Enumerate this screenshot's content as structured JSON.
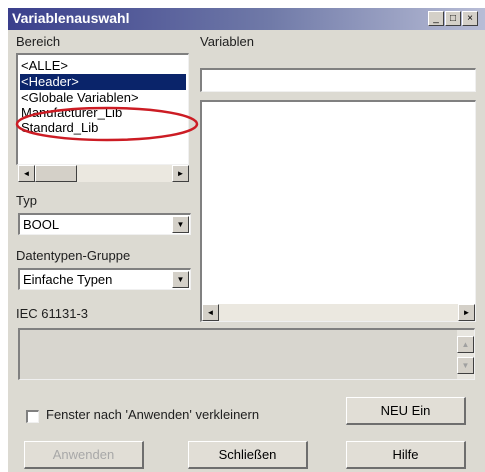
{
  "window": {
    "title": "Variablenauswahl",
    "minimize_glyph": "_",
    "maximize_glyph": "□",
    "close_glyph": "×"
  },
  "bereich": {
    "label": "Bereich",
    "items": [
      "<ALLE>",
      "<Header>",
      "<Globale Variablen>",
      "Manufacturer_Lib",
      "Standard_Lib"
    ],
    "selected_index": 1,
    "highlight_color": "#cc1c24"
  },
  "variablen": {
    "label": "Variablen",
    "filter_value": ""
  },
  "typ": {
    "label": "Typ",
    "value": "BOOL"
  },
  "datentypen": {
    "label": "Datentypen-Gruppe",
    "value": "Einfache Typen"
  },
  "iec": {
    "label": "IEC 61131-3",
    "text": ""
  },
  "checkbox": {
    "label": "Fenster nach 'Anwenden' verkleinern",
    "checked": false
  },
  "buttons": {
    "neu_ein": "NEU Ein",
    "anwenden": "Anwenden",
    "schliessen": "Schließen",
    "hilfe": "Hilfe"
  },
  "icons": {
    "arrow_left": "◄",
    "arrow_right": "►",
    "arrow_down": "▼",
    "arrow_up": "▲"
  }
}
